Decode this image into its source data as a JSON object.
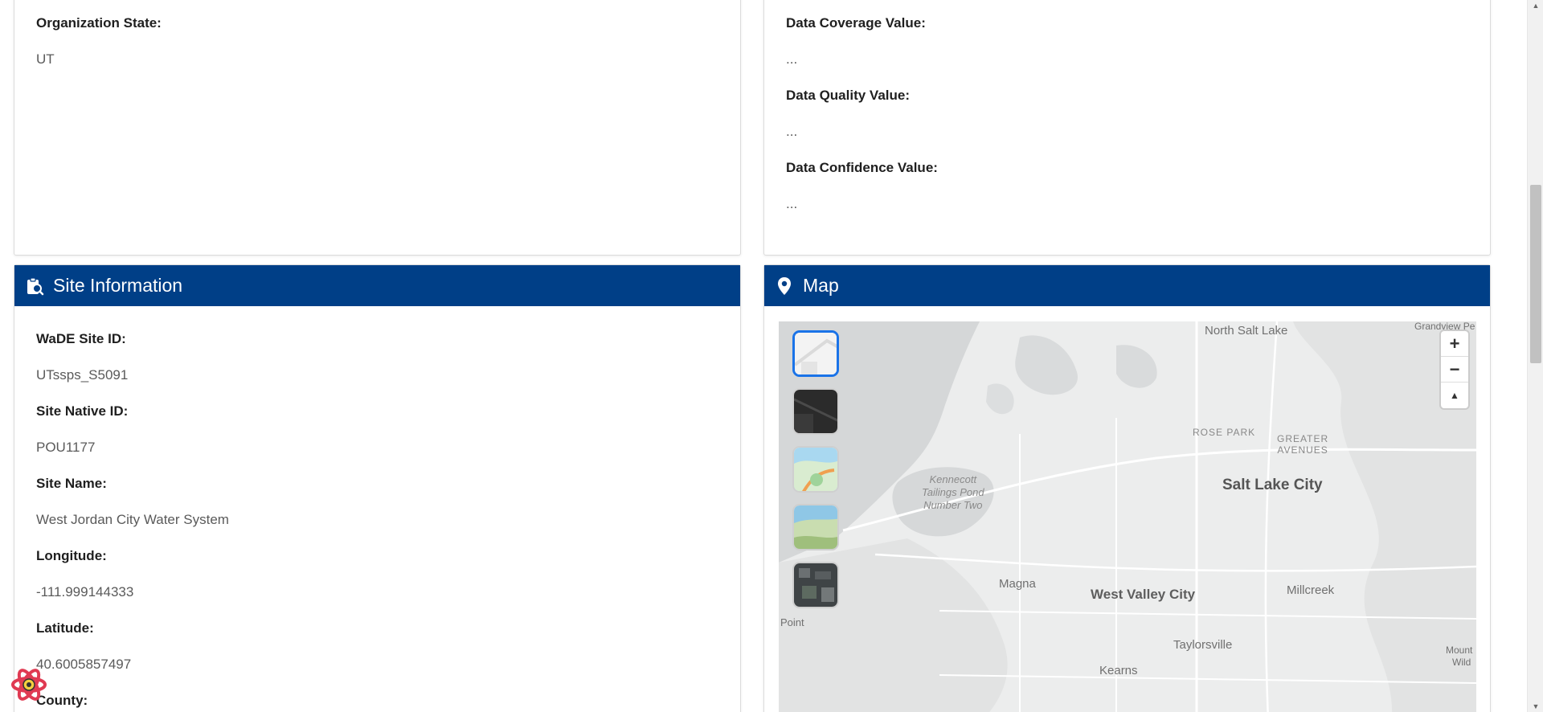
{
  "org_card": {
    "state_label": "Organization State:",
    "state_value": "UT"
  },
  "data_card": {
    "coverage_label": "Data Coverage Value:",
    "coverage_value": "...",
    "quality_label": "Data Quality Value:",
    "quality_value": "...",
    "confidence_label": "Data Confidence Value:",
    "confidence_value": "..."
  },
  "site_card": {
    "title": "Site Information",
    "icon": "clipboard-search-icon",
    "fields": [
      {
        "label": "WaDE Site ID:",
        "value": "UTssps_S5091"
      },
      {
        "label": "Site Native ID:",
        "value": "POU1177"
      },
      {
        "label": "Site Name:",
        "value": "West Jordan City Water System"
      },
      {
        "label": "Longitude:",
        "value": "-111.999144333"
      },
      {
        "label": "Latitude:",
        "value": "40.6005857497"
      },
      {
        "label": "County:",
        "value": ""
      }
    ]
  },
  "map_card": {
    "title": "Map",
    "icon": "map-pin-icon",
    "zoom_in": "+",
    "zoom_out": "−",
    "compass": "▲",
    "style_options": [
      "light",
      "dark",
      "streets",
      "outdoors",
      "satellite"
    ],
    "active_style": "light",
    "labels": {
      "north_salt_lake": "North Salt Lake",
      "grandview": "Grandview Pe",
      "rose_park": "ROSE PARK",
      "greater_avenues_1": "GREATER",
      "greater_avenues_2": "AVENUES",
      "salt_lake_city": "Salt Lake City",
      "kennecott_1": "Kennecott",
      "kennecott_2": "Tailings Pond",
      "kennecott_3": "Number Two",
      "magna": "Magna",
      "west_valley_city": "West Valley City",
      "millcreek": "Millcreek",
      "point": "Point",
      "taylorsville": "Taylorsville",
      "kearns": "Kearns",
      "mount_1": "Mount",
      "mount_2": "Wild"
    }
  },
  "colors": {
    "header_bg": "#003f87",
    "active_style_border": "#1a73e8"
  }
}
